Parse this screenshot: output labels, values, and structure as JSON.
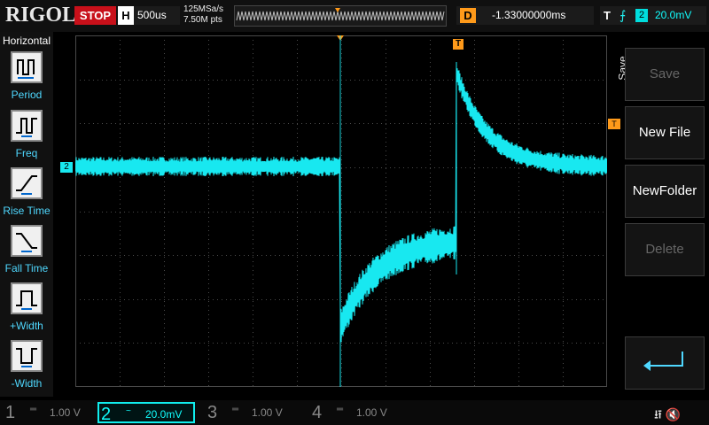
{
  "colors": {
    "trace": "#18e8f0",
    "grid": "#4a4a4a",
    "trigger_marker": "#ff9a1a",
    "stop": "#c8101a",
    "menu_label": "#4fd8ff"
  },
  "header": {
    "brand": "RIGOL",
    "run_state": "STOP",
    "timebase": {
      "label": "H",
      "value": "500us"
    },
    "sample_rate": "125MSa/s",
    "memory_points": "7.50M pts",
    "delay": {
      "label": "D",
      "value": "-1.33000000ms"
    },
    "trigger": {
      "label": "T",
      "edge_icon": "rising-edge-icon",
      "source": "2",
      "level": "20.0mV"
    }
  },
  "left_menu": {
    "title": "Horizontal",
    "items": [
      {
        "label": "Period",
        "icon": "period-icon"
      },
      {
        "label": "Freq",
        "icon": "freq-icon"
      },
      {
        "label": "Rise Time",
        "icon": "rise-time-icon"
      },
      {
        "label": "Fall Time",
        "icon": "fall-time-icon"
      },
      {
        "label": "+Width",
        "icon": "plus-width-icon"
      },
      {
        "label": "-Width",
        "icon": "minus-width-icon"
      }
    ]
  },
  "right_menu": {
    "title": "Save",
    "items": [
      {
        "label": "Save",
        "enabled": false
      },
      {
        "label": "New File",
        "enabled": true
      },
      {
        "label": "NewFolder",
        "enabled": true
      },
      {
        "label": "Delete",
        "enabled": false
      }
    ],
    "enter_icon": "enter-icon"
  },
  "markers": {
    "channel_marker": "2",
    "trigger_marker": "T"
  },
  "channels": [
    {
      "number": "1",
      "coupling": "═",
      "scale": "1.00 V",
      "active": false
    },
    {
      "number": "2",
      "coupling": "~",
      "scale": "20.0mV",
      "active": true
    },
    {
      "number": "3",
      "coupling": "═",
      "scale": "1.00 V",
      "active": false
    },
    {
      "number": "4",
      "coupling": "═",
      "scale": "1.00 V",
      "active": false
    }
  ],
  "status_icons": [
    "usb-icon",
    "speaker-muted-icon"
  ]
}
